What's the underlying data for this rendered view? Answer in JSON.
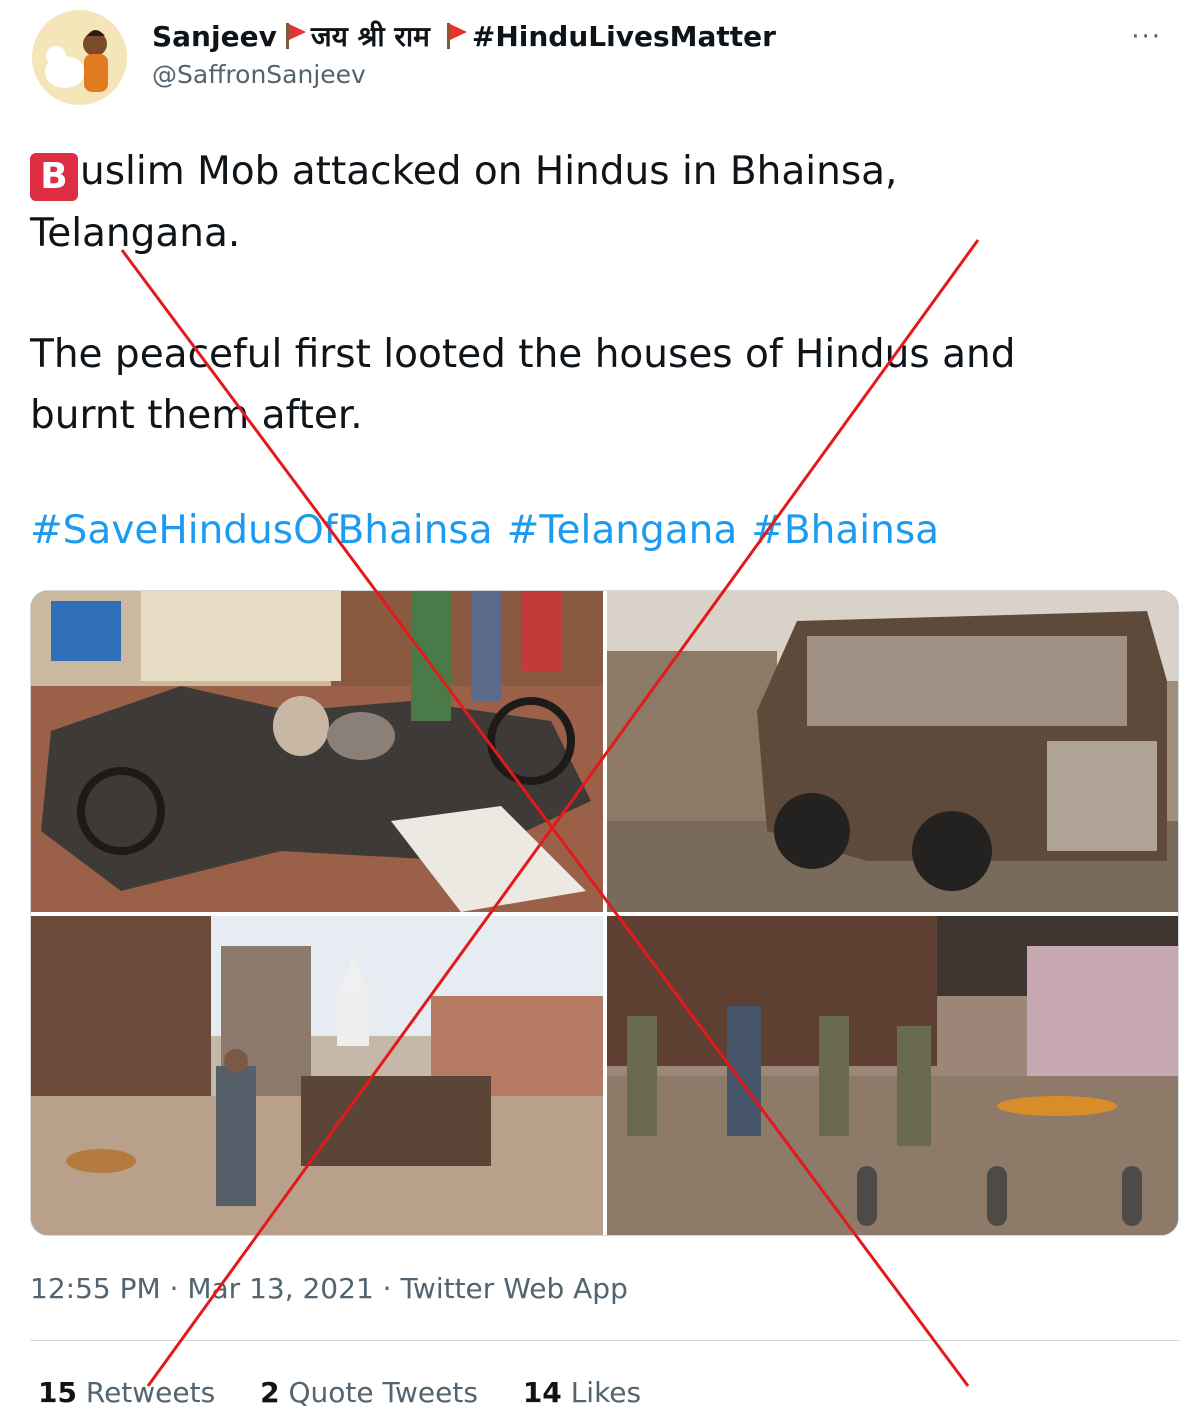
{
  "tweet": {
    "display_name": "Sanjeev",
    "name_devanagari": "जय श्री राम",
    "name_hashtag": "#HinduLivesMatter",
    "handle": "@SaffronSanjeev",
    "more_icon": "···",
    "badge_letter": "B",
    "line1": "uslim Mob attacked on Hindus in Bhainsa,",
    "line2": "Telangana.",
    "line3": "The peaceful first looted the houses of Hindus and",
    "line4": "burnt them after.",
    "hashtags": [
      "#SaveHindusOfBhainsa",
      "#Telangana",
      "#Bhainsa"
    ],
    "timestamp": "12:55 PM · Mar 13, 2021 · Twitter Web App",
    "stats": [
      {
        "count": "15",
        "label": "Retweets"
      },
      {
        "count": "2",
        "label": "Quote Tweets"
      },
      {
        "count": "14",
        "label": "Likes"
      }
    ]
  },
  "colors": {
    "link": "#1d9bf0",
    "muted": "#536471",
    "cross": "#e3191c",
    "flag": "#e5342f",
    "badge": "#dd2e44"
  },
  "icons": [
    "avatar",
    "flag-icon",
    "more-icon"
  ]
}
